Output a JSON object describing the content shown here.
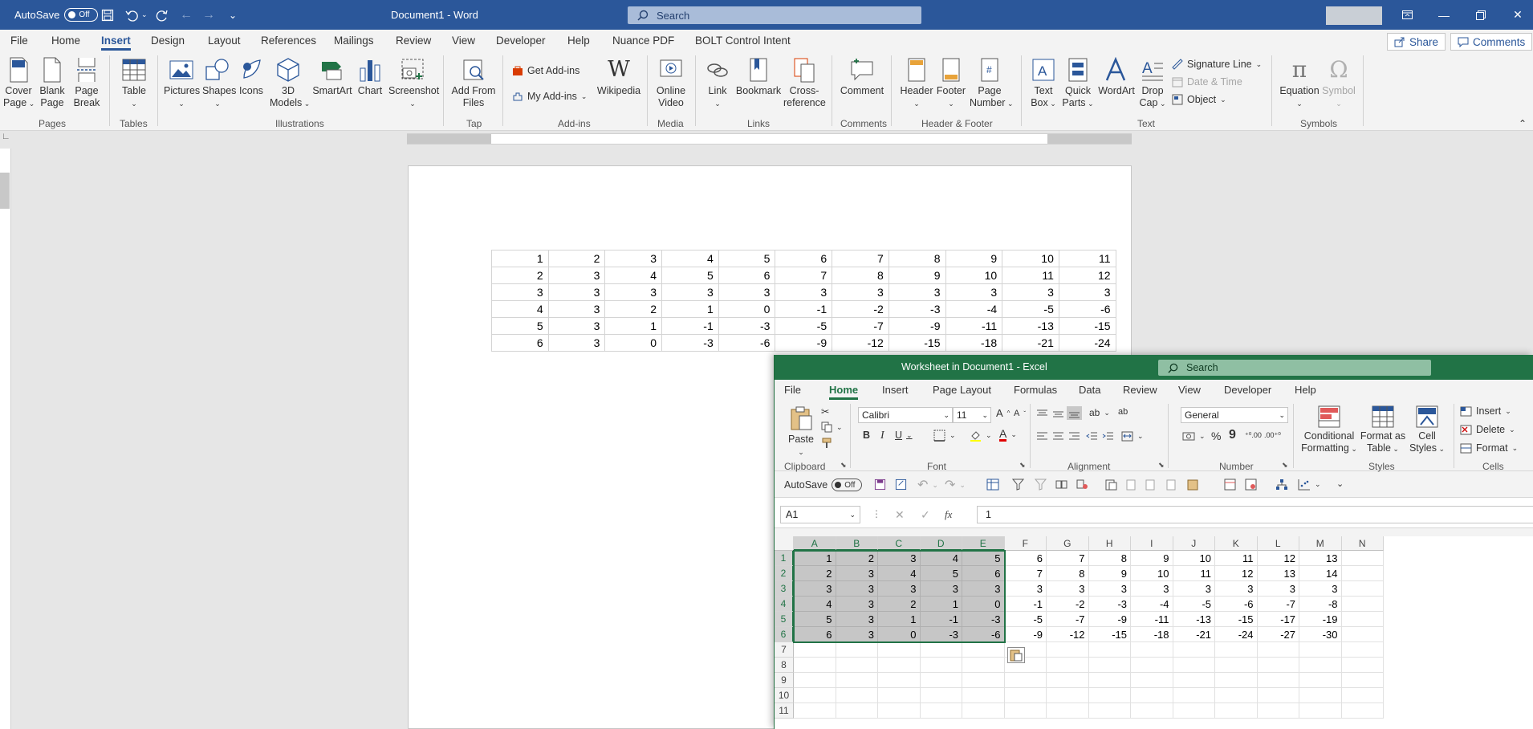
{
  "word": {
    "autosave_label": "AutoSave",
    "autosave_state": "Off",
    "doc_title": "Document1  -  Word",
    "search_placeholder": "Search",
    "tabs": [
      "File",
      "Home",
      "Insert",
      "Design",
      "Layout",
      "References",
      "Mailings",
      "Review",
      "View",
      "Developer",
      "Help",
      "Nuance PDF",
      "BOLT Control Intent"
    ],
    "active_tab": "Insert",
    "share_label": "Share",
    "comments_label": "Comments",
    "ribbon": {
      "cover_page": "Cover Page",
      "cover_page_l1": "Cover",
      "cover_page_l2": "Page",
      "blank_page_l1": "Blank",
      "blank_page_l2": "Page",
      "page_break_l1": "Page",
      "page_break_l2": "Break",
      "table": "Table",
      "pictures": "Pictures",
      "shapes": "Shapes",
      "icons": "Icons",
      "models_l1": "3D",
      "models_l2": "Models",
      "smartart": "SmartArt",
      "chart": "Chart",
      "screenshot": "Screenshot",
      "add_from_files_l1": "Add From",
      "add_from_files_l2": "Files",
      "get_addins": "Get Add-ins",
      "my_addins": "My Add-ins",
      "wikipedia": "Wikipedia",
      "online_video_l1": "Online",
      "online_video_l2": "Video",
      "link": "Link",
      "bookmark": "Bookmark",
      "cross_ref_l1": "Cross-",
      "cross_ref_l2": "reference",
      "comment": "Comment",
      "header": "Header",
      "footer": "Footer",
      "page_number_l1": "Page",
      "page_number_l2": "Number",
      "text_box_l1": "Text",
      "text_box_l2": "Box",
      "quick_parts_l1": "Quick",
      "quick_parts_l2": "Parts",
      "wordart": "WordArt",
      "drop_cap_l1": "Drop",
      "drop_cap_l2": "Cap",
      "signature_line": "Signature Line",
      "date_time": "Date & Time",
      "object": "Object",
      "equation": "Equation",
      "symbol": "Symbol",
      "groups": {
        "pages": "Pages",
        "tables": "Tables",
        "illustrations": "Illustrations",
        "tap": "Tap",
        "addins": "Add-ins",
        "media": "Media",
        "links": "Links",
        "comments": "Comments",
        "header_footer": "Header & Footer",
        "text": "Text",
        "symbols": "Symbols"
      }
    },
    "table_rows": [
      [
        "1",
        "2",
        "3",
        "4",
        "5",
        "6",
        "7",
        "8",
        "9",
        "10",
        "11"
      ],
      [
        "2",
        "3",
        "4",
        "5",
        "6",
        "7",
        "8",
        "9",
        "10",
        "11",
        "12"
      ],
      [
        "3",
        "3",
        "3",
        "3",
        "3",
        "3",
        "3",
        "3",
        "3",
        "3",
        "3"
      ],
      [
        "4",
        "3",
        "2",
        "1",
        "0",
        "-1",
        "-2",
        "-3",
        "-4",
        "-5",
        "-6"
      ],
      [
        "5",
        "3",
        "1",
        "-1",
        "-3",
        "-5",
        "-7",
        "-9",
        "-11",
        "-13",
        "-15"
      ],
      [
        "6",
        "3",
        "0",
        "-3",
        "-6",
        "-9",
        "-12",
        "-15",
        "-18",
        "-21",
        "-24"
      ]
    ]
  },
  "excel": {
    "title": "Worksheet in Document1  -  Excel",
    "search_placeholder": "Search",
    "tabs": [
      "File",
      "Home",
      "Insert",
      "Page Layout",
      "Formulas",
      "Data",
      "Review",
      "View",
      "Developer",
      "Help"
    ],
    "active_tab": "Home",
    "ribbon": {
      "paste": "Paste",
      "font_name": "Calibri",
      "font_size": "11",
      "number_format": "General",
      "conditional_l1": "Conditional",
      "conditional_l2": "Formatting",
      "format_table_l1": "Format as",
      "format_table_l2": "Table",
      "cell_styles_l1": "Cell",
      "cell_styles_l2": "Styles",
      "insert": "Insert",
      "delete": "Delete",
      "format": "Format",
      "groups": {
        "clipboard": "Clipboard",
        "font": "Font",
        "alignment": "Alignment",
        "number": "Number",
        "styles": "Styles",
        "cells": "Cells"
      }
    },
    "qat_autosave": "AutoSave",
    "qat_autosave_state": "Off",
    "name_box": "A1",
    "formula_value": "1",
    "fx_label": "fx",
    "columns": [
      "A",
      "B",
      "C",
      "D",
      "E",
      "F",
      "G",
      "H",
      "I",
      "J",
      "K",
      "L",
      "M",
      "N"
    ],
    "row_numbers": [
      "1",
      "2",
      "3",
      "4",
      "5",
      "6",
      "7",
      "8",
      "9",
      "10",
      "11"
    ],
    "cells": [
      [
        "1",
        "2",
        "3",
        "4",
        "5",
        "6",
        "7",
        "8",
        "9",
        "10",
        "11",
        "12",
        "13",
        ""
      ],
      [
        "2",
        "3",
        "4",
        "5",
        "6",
        "7",
        "8",
        "9",
        "10",
        "11",
        "12",
        "13",
        "14",
        ""
      ],
      [
        "3",
        "3",
        "3",
        "3",
        "3",
        "3",
        "3",
        "3",
        "3",
        "3",
        "3",
        "3",
        "3",
        ""
      ],
      [
        "4",
        "3",
        "2",
        "1",
        "0",
        "-1",
        "-2",
        "-3",
        "-4",
        "-5",
        "-6",
        "-7",
        "-8",
        ""
      ],
      [
        "5",
        "3",
        "1",
        "-1",
        "-3",
        "-5",
        "-7",
        "-9",
        "-11",
        "-13",
        "-15",
        "-17",
        "-19",
        ""
      ],
      [
        "6",
        "3",
        "0",
        "-3",
        "-6",
        "-9",
        "-12",
        "-15",
        "-18",
        "-21",
        "-24",
        "-27",
        "-30",
        ""
      ]
    ]
  },
  "colors": {
    "word_blue": "#2b579a",
    "excel_green": "#217346"
  }
}
